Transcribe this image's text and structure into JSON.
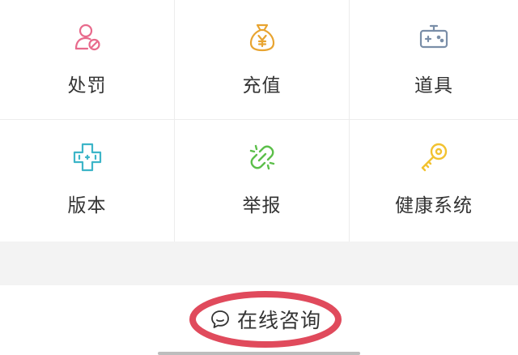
{
  "grid": {
    "items": [
      {
        "label": "处罚",
        "icon": "user-ban-icon",
        "color": "#e86a8c"
      },
      {
        "label": "充值",
        "icon": "money-bag-icon",
        "color": "#e8a430"
      },
      {
        "label": "道具",
        "icon": "gamepad-icon",
        "color": "#7a8ea8"
      },
      {
        "label": "版本",
        "icon": "dpad-icon",
        "color": "#3db5c8"
      },
      {
        "label": "举报",
        "icon": "broken-link-icon",
        "color": "#5cbf4a"
      },
      {
        "label": "健康系统",
        "icon": "key-icon",
        "color": "#f2c230"
      }
    ]
  },
  "bottom": {
    "consult_label": "在线咨询",
    "consult_icon": "chat-bubble-icon",
    "highlight_color": "#e04a5c"
  }
}
